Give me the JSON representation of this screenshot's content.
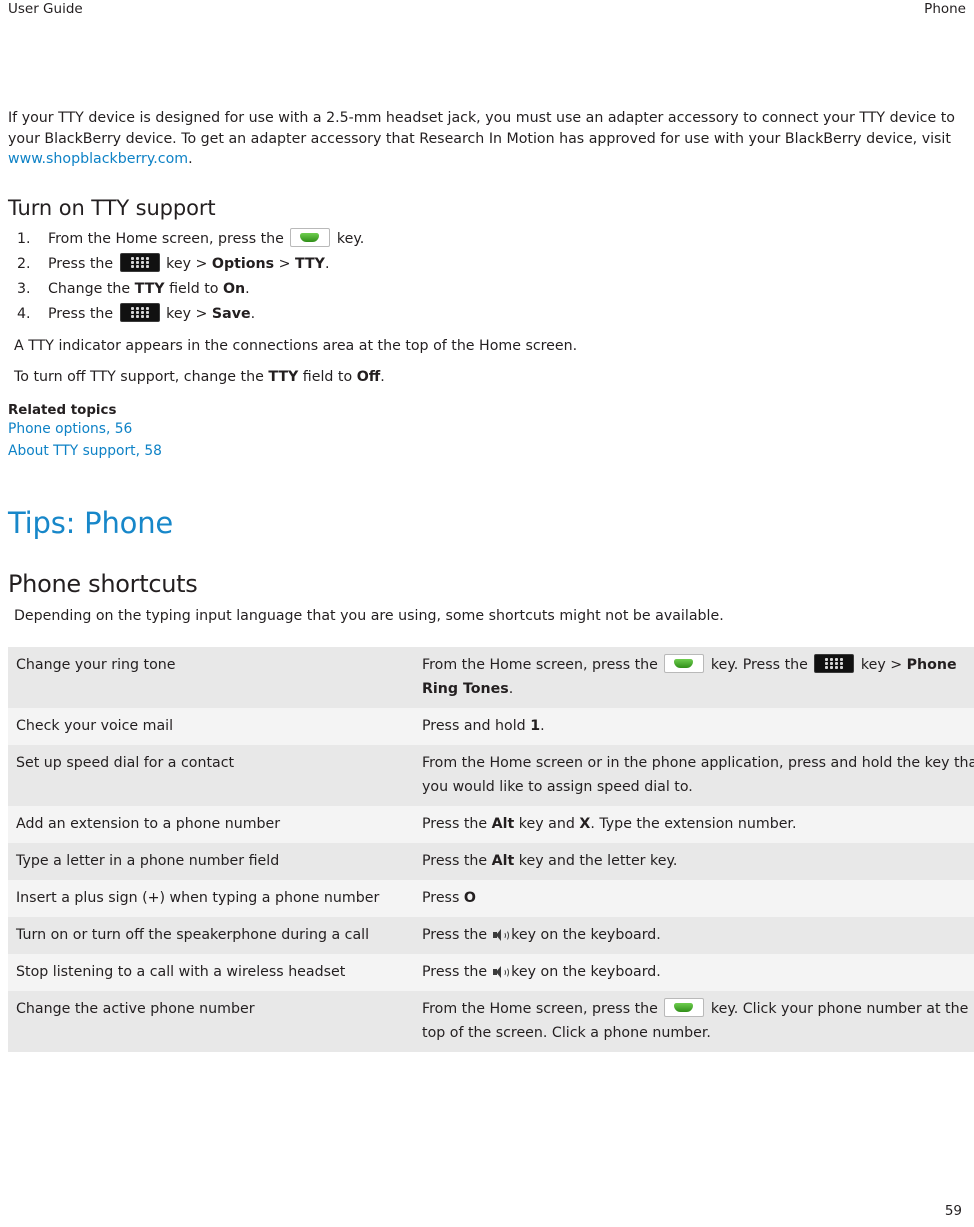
{
  "header": {
    "left": "User Guide",
    "right": "Phone"
  },
  "intro": {
    "text_before_link": "If your TTY device is designed for use with a 2.5-mm headset jack, you must use an adapter accessory to connect your TTY device to your BlackBerry device. To get an adapter accessory that Research In Motion has approved for use with your BlackBerry device, visit ",
    "link": "www.shopblackberry.com",
    "text_after_link": "."
  },
  "tty_section": {
    "title": "Turn on TTY support",
    "steps": [
      {
        "num": "1.",
        "parts": [
          {
            "t": "text",
            "v": "From the Home screen, press the "
          },
          {
            "t": "icon",
            "v": "send-key-icon"
          },
          {
            "t": "text",
            "v": " key."
          }
        ]
      },
      {
        "num": "2.",
        "parts": [
          {
            "t": "text",
            "v": "Press the "
          },
          {
            "t": "icon",
            "v": "menu-key-icon"
          },
          {
            "t": "text",
            "v": " key > "
          },
          {
            "t": "bold",
            "v": "Options"
          },
          {
            "t": "text",
            "v": " > "
          },
          {
            "t": "bold",
            "v": "TTY"
          },
          {
            "t": "text",
            "v": "."
          }
        ]
      },
      {
        "num": "3.",
        "parts": [
          {
            "t": "text",
            "v": "Change the "
          },
          {
            "t": "bold",
            "v": "TTY"
          },
          {
            "t": "text",
            "v": " field to "
          },
          {
            "t": "bold",
            "v": "On"
          },
          {
            "t": "text",
            "v": "."
          }
        ]
      },
      {
        "num": "4.",
        "parts": [
          {
            "t": "text",
            "v": "Press the "
          },
          {
            "t": "icon",
            "v": "menu-key-icon"
          },
          {
            "t": "text",
            "v": " key > "
          },
          {
            "t": "bold",
            "v": "Save"
          },
          {
            "t": "text",
            "v": "."
          }
        ]
      }
    ],
    "note1": "A TTY indicator appears in the connections area at the top of the Home screen.",
    "note2_parts": [
      {
        "t": "text",
        "v": "To turn off TTY support, change the "
      },
      {
        "t": "bold",
        "v": "TTY"
      },
      {
        "t": "text",
        "v": " field to "
      },
      {
        "t": "bold",
        "v": "Off"
      },
      {
        "t": "text",
        "v": "."
      }
    ],
    "related_title": "Related topics",
    "related_links": [
      "Phone options, 56",
      "About TTY support, 58"
    ]
  },
  "chapter": {
    "title": "Tips: Phone"
  },
  "shortcuts_section": {
    "title": "Phone shortcuts",
    "note": "Depending on the typing input language that you are using, some shortcuts might not be available.",
    "rows": [
      {
        "label": "Change your ring tone",
        "parts": [
          {
            "t": "text",
            "v": "From the Home screen, press the "
          },
          {
            "t": "icon",
            "v": "send-key-icon"
          },
          {
            "t": "text",
            "v": " key. Press the "
          },
          {
            "t": "icon",
            "v": "menu-key-icon"
          },
          {
            "t": "text",
            "v": " key > "
          },
          {
            "t": "bold",
            "v": "Phone Ring Tones"
          },
          {
            "t": "text",
            "v": "."
          }
        ]
      },
      {
        "label": "Check your voice mail",
        "parts": [
          {
            "t": "text",
            "v": "Press and hold "
          },
          {
            "t": "bold",
            "v": "1"
          },
          {
            "t": "text",
            "v": "."
          }
        ]
      },
      {
        "label": "Set up speed dial for a contact",
        "parts": [
          {
            "t": "text",
            "v": "From the Home screen or in the phone application, press and hold the key that you would like to assign speed dial to."
          }
        ]
      },
      {
        "label": "Add an extension to a phone number",
        "parts": [
          {
            "t": "text",
            "v": "Press the "
          },
          {
            "t": "bold",
            "v": "Alt"
          },
          {
            "t": "text",
            "v": " key and "
          },
          {
            "t": "bold",
            "v": "X"
          },
          {
            "t": "text",
            "v": ". Type the extension number."
          }
        ]
      },
      {
        "label": "Type a letter in a phone number field",
        "parts": [
          {
            "t": "text",
            "v": "Press the "
          },
          {
            "t": "bold",
            "v": "Alt"
          },
          {
            "t": "text",
            "v": " key and the letter key."
          }
        ]
      },
      {
        "label": "Insert a plus sign (+) when typing a phone number",
        "parts": [
          {
            "t": "text",
            "v": "Press "
          },
          {
            "t": "bold",
            "v": "O"
          }
        ]
      },
      {
        "label": "Turn on or turn off the speakerphone during a call",
        "parts": [
          {
            "t": "text",
            "v": "Press the "
          },
          {
            "t": "icon",
            "v": "speaker-icon"
          },
          {
            "t": "text",
            "v": " key on the keyboard."
          }
        ]
      },
      {
        "label": "Stop listening to a call with a wireless headset",
        "parts": [
          {
            "t": "text",
            "v": "Press the "
          },
          {
            "t": "icon",
            "v": "speaker-icon"
          },
          {
            "t": "text",
            "v": " key on the keyboard."
          }
        ]
      },
      {
        "label": "Change the active phone number",
        "parts": [
          {
            "t": "text",
            "v": "From the Home screen, press the "
          },
          {
            "t": "icon",
            "v": "send-key-icon"
          },
          {
            "t": "text",
            "v": " key. Click your phone number at the top of the screen. Click a phone number."
          }
        ]
      }
    ]
  },
  "footer": {
    "page_number": "59"
  }
}
